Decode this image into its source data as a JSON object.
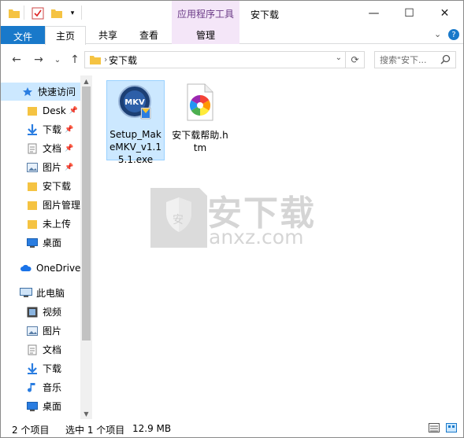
{
  "titlebar": {
    "context_tab": "应用程序工具",
    "title": "安下载",
    "minimize": "—",
    "maximize": "☐",
    "close": "✕"
  },
  "ribbon": {
    "tabs": [
      "文件",
      "主页",
      "共享",
      "查看",
      "管理"
    ],
    "expand": "⌄",
    "help": "?"
  },
  "nav": {
    "back": "←",
    "forward": "→",
    "recent": "⌄",
    "up": "↑",
    "path": "安下载",
    "search_placeholder": "搜索\"安下...",
    "refresh": "⟳"
  },
  "navpane": {
    "items": [
      {
        "label": "快速访问",
        "icon": "star-icon"
      },
      {
        "label": "Desk",
        "icon": "folder-icon",
        "pinned": true
      },
      {
        "label": "下载",
        "icon": "download-icon",
        "pinned": true
      },
      {
        "label": "文档",
        "icon": "document-icon",
        "pinned": true
      },
      {
        "label": "图片",
        "icon": "picture-icon",
        "pinned": true
      },
      {
        "label": "安下载",
        "icon": "folder-icon"
      },
      {
        "label": "图片管理",
        "icon": "folder-icon"
      },
      {
        "label": "未上传",
        "icon": "folder-icon"
      },
      {
        "label": "桌面",
        "icon": "desktop-icon"
      },
      {
        "label": "OneDrive",
        "icon": "cloud-icon"
      },
      {
        "label": "此电脑",
        "icon": "computer-icon"
      },
      {
        "label": "视频",
        "icon": "video-icon"
      },
      {
        "label": "图片",
        "icon": "picture-icon"
      },
      {
        "label": "文档",
        "icon": "document-icon"
      },
      {
        "label": "下载",
        "icon": "download-icon"
      },
      {
        "label": "音乐",
        "icon": "music-icon"
      },
      {
        "label": "桌面",
        "icon": "desktop-icon"
      }
    ]
  },
  "files": [
    {
      "name": "Setup_MakeMKV_v1.15.1.exe",
      "icon": "makemkv-icon",
      "selected": true
    },
    {
      "name": "安下载帮助.htm",
      "icon": "htm-file-icon",
      "selected": false
    }
  ],
  "watermark": {
    "text": "安下载",
    "sub": "anxz.com",
    "badge": "安"
  },
  "status": {
    "count": "2 个项目",
    "selected": "选中 1 个项目",
    "size": "12.9 MB"
  },
  "colors": {
    "accent": "#1979ca",
    "selection": "#cce8ff",
    "context_tab": "#f4e6f8"
  }
}
